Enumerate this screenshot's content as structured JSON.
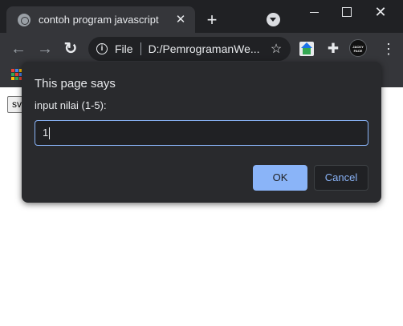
{
  "tab": {
    "title": "contoh program javascript",
    "favicon": "globe-icon"
  },
  "toolbar": {
    "url_scheme": "File",
    "url": "D:/PemrogramanWe...",
    "avatar_text": "JACKY FACE"
  },
  "page": {
    "button_label": "sv"
  },
  "dialog": {
    "title": "This page says",
    "message": "input nilai (1-5):",
    "input_value": "1",
    "ok_label": "OK",
    "cancel_label": "Cancel"
  },
  "colors": {
    "accent": "#8ab4f8",
    "dialog_bg": "#292a2d",
    "frame_bg": "#202124",
    "toolbar_bg": "#35363a"
  },
  "icons": {
    "apps": "apps-grid-icon",
    "home": "home-icon",
    "extensions": "puzzle-icon",
    "bookmark": "star-icon"
  }
}
